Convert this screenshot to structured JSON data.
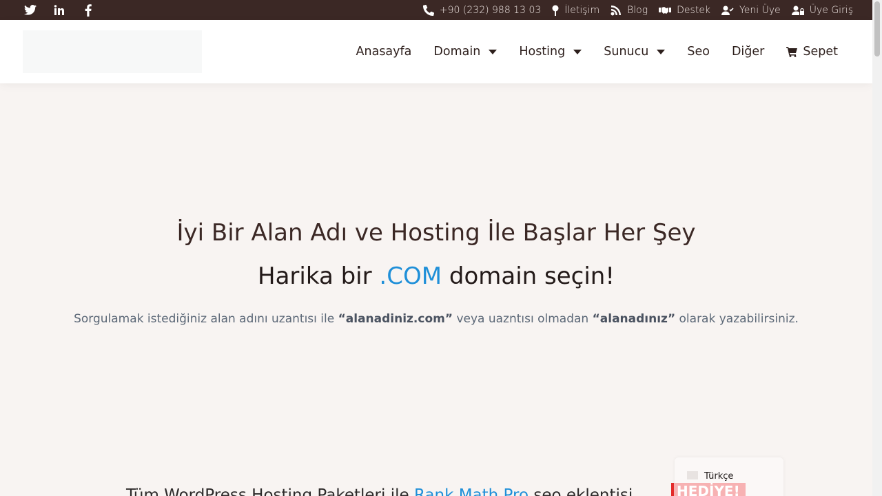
{
  "topbar": {
    "social": [
      "twitter-icon",
      "linkedin-icon",
      "facebook-icon"
    ],
    "phone": "+90 (232) 988 13 03",
    "contact": "İletişim",
    "blog": "Blog",
    "support": "Destek",
    "new_member": "Yeni Üye",
    "login": "Üye Giriş"
  },
  "nav": {
    "home": "Anasayfa",
    "domain": "Domain",
    "hosting": "Hosting",
    "server": "Sunucu",
    "seo": "Seo",
    "other": "Diğer",
    "cart": "Sepet"
  },
  "hero": {
    "title": "İyi Bir Alan Adı ve Hosting İle Başlar Her Şey",
    "subtitle_pre": "Harika bir ",
    "subtitle_accent": ".COM",
    "subtitle_post": " domain seçin!",
    "desc_1": "Sorgulamak istediğiniz alan adını uzantısı ile ",
    "desc_b1": "“alanadiniz.com”",
    "desc_2": " veya uazntısı olmadan ",
    "desc_b2": "“alanadınız”",
    "desc_3": " olarak yazabilirsiniz."
  },
  "promo": {
    "text_pre": "Tüm WordPress Hosting Paketleri ile ",
    "text_blue": "Rank Math Pro",
    "text_post": " seo eklentisi",
    "badge": "HEDİYE!"
  },
  "language": {
    "label": "Türkçe"
  },
  "colors": {
    "topbar": "#3b2825",
    "accent": "#1f8fd8",
    "background": "#f8f4f2"
  }
}
